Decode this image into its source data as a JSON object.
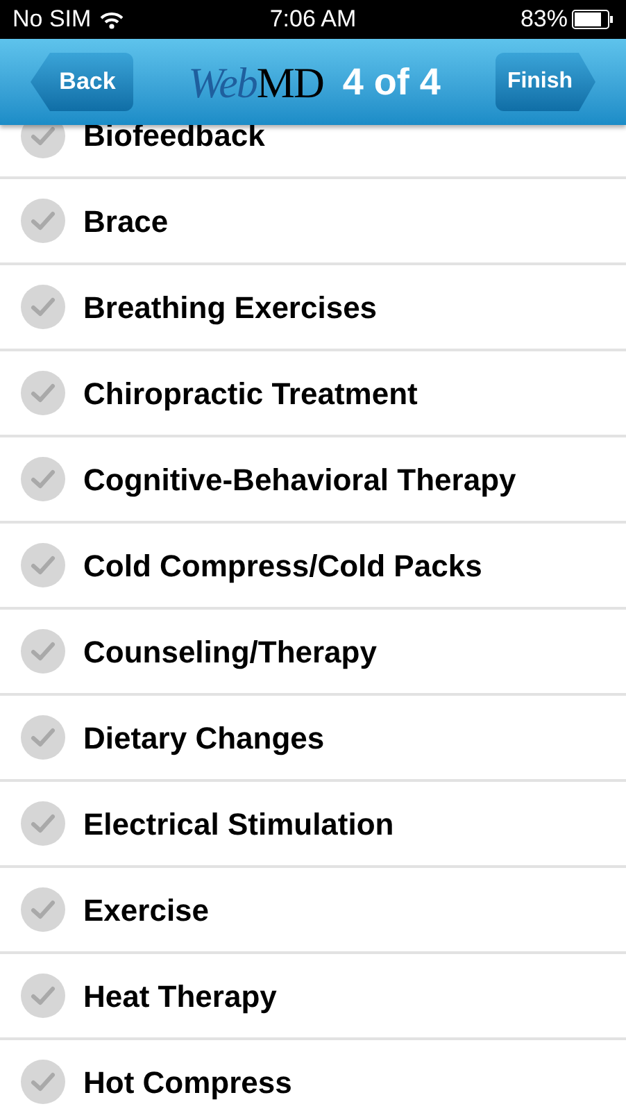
{
  "status_bar": {
    "carrier": "No SIM",
    "time": "7:06 AM",
    "battery": "83%"
  },
  "header": {
    "back": "Back",
    "logo": [
      "Web",
      "MD"
    ],
    "title": "4 of 4",
    "finish": "Finish"
  },
  "items": [
    {
      "label": "Biofeedback",
      "checked": false
    },
    {
      "label": "Brace",
      "checked": false
    },
    {
      "label": "Breathing Exercises",
      "checked": false
    },
    {
      "label": "Chiropractic Treatment",
      "checked": false
    },
    {
      "label": "Cognitive-Behavioral Therapy",
      "checked": false
    },
    {
      "label": "Cold Compress/Cold Packs",
      "checked": false
    },
    {
      "label": "Counseling/Therapy",
      "checked": false
    },
    {
      "label": "Dietary Changes",
      "checked": false
    },
    {
      "label": "Electrical Stimulation",
      "checked": false
    },
    {
      "label": "Exercise",
      "checked": false
    },
    {
      "label": "Heat Therapy",
      "checked": false
    },
    {
      "label": "Hot Compress",
      "checked": false
    }
  ]
}
